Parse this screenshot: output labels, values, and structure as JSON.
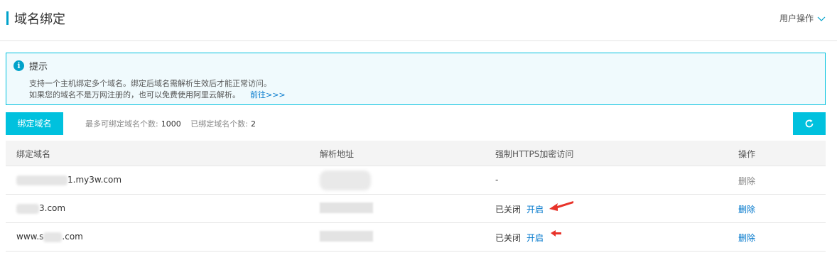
{
  "header": {
    "title": "域名绑定",
    "user_ops": "用户操作",
    "chevron_icon": "chevron-down-icon"
  },
  "tip": {
    "icon": "info-icon",
    "title": "提示",
    "line1": "支持一个主机绑定多个域名。绑定后域名需解析生效后才能正常访问。",
    "line2": "如果您的域名不是万网注册的，也可以免费使用阿里云解析。",
    "link": "前往>>>"
  },
  "toolbar": {
    "bind_label": "绑定域名",
    "max_label": "最多可绑定域名个数:",
    "max_value": "1000",
    "bound_label": "已绑定域名个数:",
    "bound_value": "2",
    "refresh_icon": "refresh-icon"
  },
  "table": {
    "headers": [
      "绑定域名",
      "解析地址",
      "强制HTTPS加密访问",
      "操作"
    ],
    "rows": [
      {
        "domain_prefix": "",
        "domain_suffix": "1.my3w.com",
        "https": "-",
        "action": "删除"
      },
      {
        "domain_prefix": "",
        "domain_suffix": "3.com",
        "https": "已关闭",
        "https_link": "开启",
        "action": "删除"
      },
      {
        "domain_prefix": "www.s",
        "domain_suffix": ".com",
        "https": "已关闭",
        "https_link": "开启",
        "action": "删除"
      }
    ]
  },
  "colors": {
    "accent": "#00c1de",
    "link": "#0077cc",
    "annotation": "#e8332a"
  }
}
